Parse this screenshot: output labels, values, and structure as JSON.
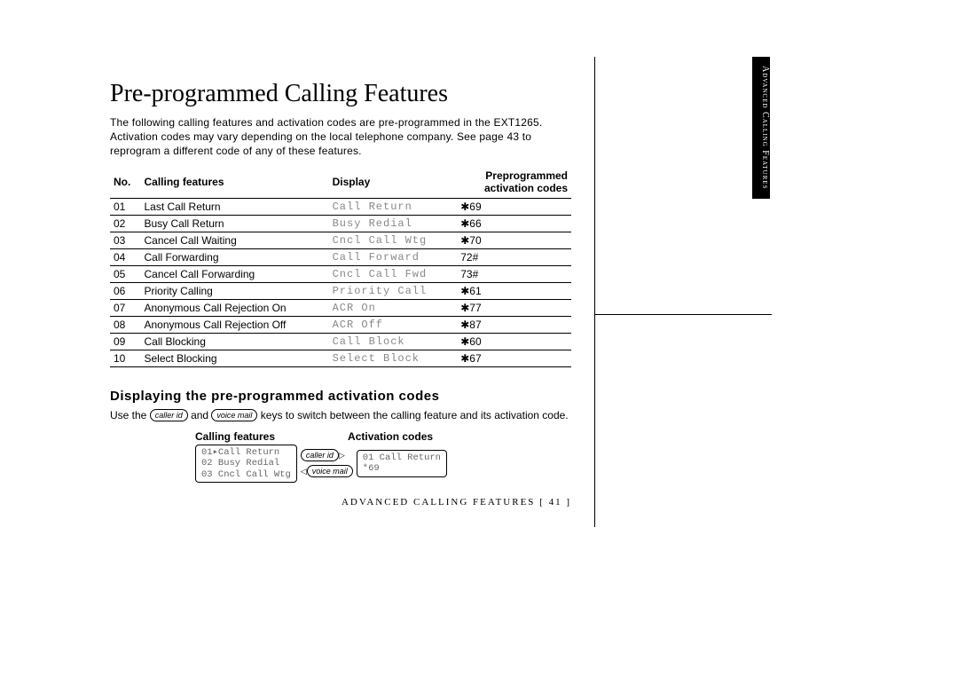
{
  "title": "Pre-programmed Calling Features",
  "intro": "The following calling features and activation codes are pre-programmed in the EXT1265. Activation codes may vary depending on the local telephone company. See page 43 to reprogram a different code of any of these features.",
  "side_tab": "Advanced Calling Features",
  "columns": {
    "no": "No.",
    "features": "Calling features",
    "display": "Display",
    "codes_l1": "Preprogrammed",
    "codes_l2": "activation codes"
  },
  "rows": [
    {
      "no": "01",
      "feature": "Last Call Return",
      "display": "Call Return",
      "code": "✱69",
      "star": true
    },
    {
      "no": "02",
      "feature": "Busy Call Return",
      "display": "Busy Redial",
      "code": "✱66",
      "star": true
    },
    {
      "no": "03",
      "feature": "Cancel Call Waiting",
      "display": "Cncl Call Wtg",
      "code": "✱70",
      "star": true
    },
    {
      "no": "04",
      "feature": "Call Forwarding",
      "display": "Call Forward",
      "code": "72#",
      "star": false
    },
    {
      "no": "05",
      "feature": "Cancel Call Forwarding",
      "display": "Cncl Call Fwd",
      "code": "73#",
      "star": false
    },
    {
      "no": "06",
      "feature": "Priority Calling",
      "display": "Priority Call",
      "code": "✱61",
      "star": true
    },
    {
      "no": "07",
      "feature": "Anonymous Call Rejection On",
      "display": "ACR On",
      "code": "✱77",
      "star": true
    },
    {
      "no": "08",
      "feature": "Anonymous Call Rejection Off",
      "display": "ACR Off",
      "code": "✱87",
      "star": true
    },
    {
      "no": "09",
      "feature": "Call Blocking",
      "display": "Call Block",
      "code": "✱60",
      "star": true
    },
    {
      "no": "10",
      "feature": "Select Blocking",
      "display": "Select Block",
      "code": "✱67",
      "star": true
    }
  ],
  "sub": {
    "title": "Displaying the pre-programmed activation codes",
    "intro_a": "Use the ",
    "intro_b": " and ",
    "intro_c": " keys to switch between the calling feature and its activation code."
  },
  "keys": {
    "caller_id": "caller id",
    "voice_mail": "voice mail"
  },
  "screens": {
    "header_left": "Calling features",
    "header_right": "Activation codes",
    "left": {
      "l1": "01▸Call Return",
      "l2": "02 Busy Redial",
      "l3": "03 Cncl Call Wtg"
    },
    "right": {
      "l1": "01 Call Return",
      "l2": "*69"
    }
  },
  "footer": {
    "section": "ADVANCED CALLING FEATURES",
    "page": "[ 41 ]"
  }
}
